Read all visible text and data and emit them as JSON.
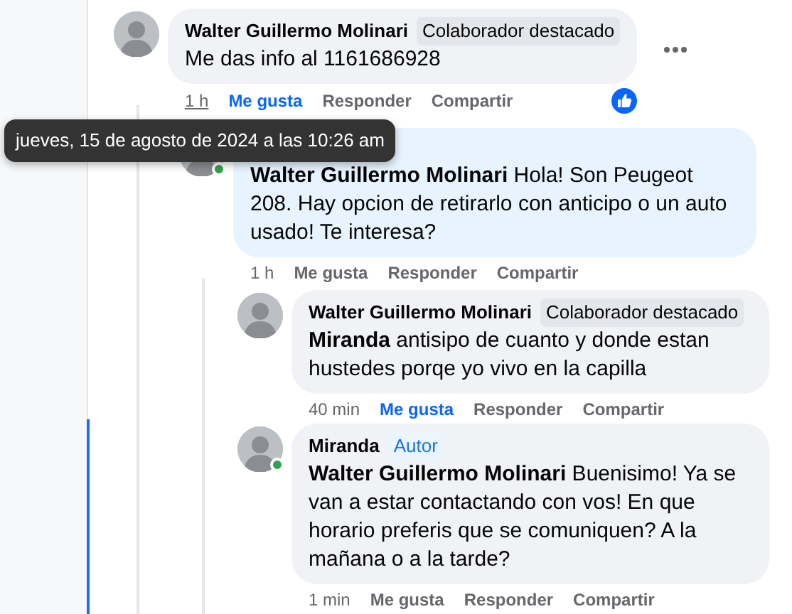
{
  "tooltip": {
    "text": "jueves, 15 de agosto de 2024 a las 10:26 am"
  },
  "comments": [
    {
      "author": "Walter Guillermo Molinari",
      "badge": {
        "label": "Colaborador destacado",
        "kind": "contributor"
      },
      "text": "Me das info al 1161686928",
      "show_menu": true,
      "reaction": true,
      "time": "1 h",
      "time_hovered": true,
      "actions": [
        {
          "label": "Me gusta",
          "selected": true
        },
        {
          "label": "Responder",
          "selected": false
        },
        {
          "label": "Compartir",
          "selected": false
        }
      ],
      "children": [
        {
          "mention": "Walter Guillermo Molinari",
          "text": "Hola! Son Peugeot 208. Hay opcion de retirarlo con anticipo o un auto usado! Te interesa?",
          "highlighted": true,
          "online": true,
          "time": "1 h",
          "time_hovered": false,
          "actions": [
            {
              "label": "Me gusta",
              "selected": false
            },
            {
              "label": "Responder",
              "selected": false
            },
            {
              "label": "Compartir",
              "selected": false
            }
          ],
          "children": [
            {
              "author": "Walter Guillermo Molinari",
              "badge": {
                "label": "Colaborador destacado",
                "kind": "contributor"
              },
              "mention": "Miranda",
              "text": "antisipo de cuanto y donde estan hustedes porqe yo vivo en la capilla",
              "time": "40 min",
              "time_hovered": false,
              "actions": [
                {
                  "label": "Me gusta",
                  "selected": true
                },
                {
                  "label": "Responder",
                  "selected": false
                },
                {
                  "label": "Compartir",
                  "selected": false
                }
              ]
            },
            {
              "author": "Miranda",
              "badge": {
                "label": "Autor",
                "kind": "author"
              },
              "mention": "Walter Guillermo Molinari",
              "text": "Buenisimo! Ya se van a estar contactando con vos! En que horario preferis que se comuniquen? A la mañana o a la tarde?",
              "online": true,
              "time": "1 min",
              "time_hovered": false,
              "actions": [
                {
                  "label": "Me gusta",
                  "selected": false
                },
                {
                  "label": "Responder",
                  "selected": false
                },
                {
                  "label": "Compartir",
                  "selected": false
                }
              ]
            }
          ]
        }
      ]
    }
  ]
}
